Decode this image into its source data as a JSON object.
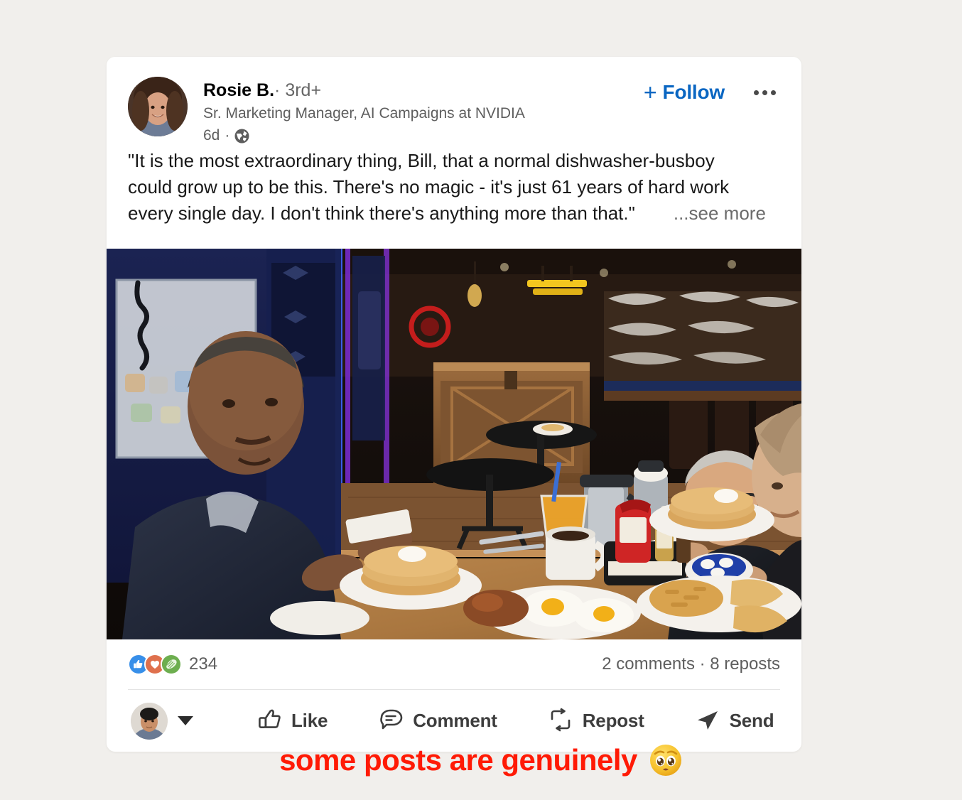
{
  "background_color": "#f1efec",
  "card": {
    "background_color": "#ffffff"
  },
  "post": {
    "author": {
      "name": "Rosie B.",
      "separator": "·",
      "degree": "3rd+",
      "headline": "Sr. Marketing Manager, AI Campaigns at NVIDIA",
      "time_ago": "6d",
      "time_separator": "·",
      "visibility_icon": "globe-icon"
    },
    "follow": {
      "plus": "+",
      "label": "Follow",
      "color": "#0a66c2"
    },
    "menu_icon": "overflow-menu-icon",
    "text_lines": [
      "\"It is the most extraordinary thing, Bill, that a normal dishwasher-busboy",
      "could grow up to be this. There's no magic - it's just 61 years of hard work",
      "every single day. I don't think there's anything more than that.\""
    ],
    "see_more": "...see more",
    "image_alt": "Two men and a server at a diner breakfast table with pancakes, eggs and hash browns",
    "social": {
      "reactions": [
        {
          "name": "like-reaction-icon",
          "color": "#378fe9"
        },
        {
          "name": "love-reaction-icon",
          "color": "#df704d"
        },
        {
          "name": "celebrate-reaction-icon",
          "color": "#6dae4f"
        }
      ],
      "reaction_count": "234",
      "comments_reposts": "2 comments · 8 reposts"
    },
    "actions": [
      {
        "icon": "thumbs-up-icon",
        "label": "Like"
      },
      {
        "icon": "comment-bubble-icon",
        "label": "Comment"
      },
      {
        "icon": "repost-icon",
        "label": "Repost"
      },
      {
        "icon": "send-plane-icon",
        "label": "Send"
      }
    ]
  },
  "caption": {
    "text": "some posts are genuinely",
    "emoji": "pleading-face-emoji",
    "color": "#ff1a05"
  }
}
